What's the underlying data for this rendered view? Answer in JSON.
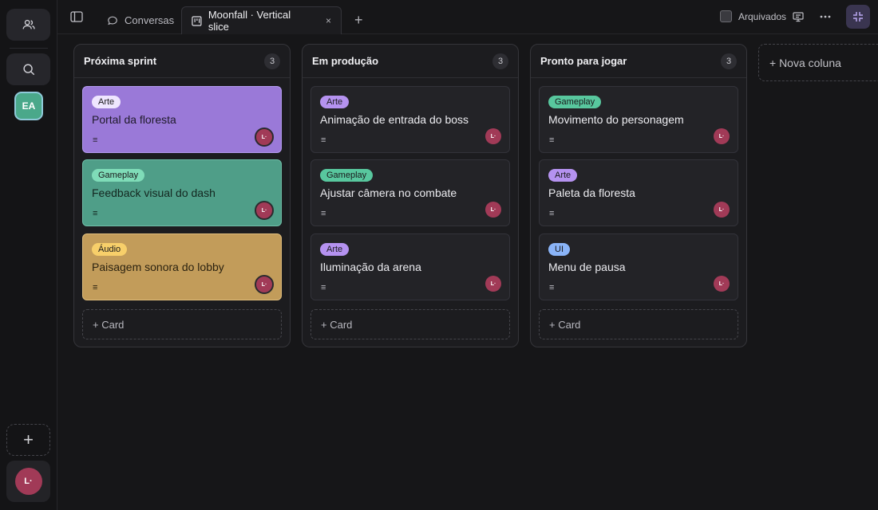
{
  "rail": {
    "workspace_initials": "EA",
    "user_initials": "L·",
    "add_label": "+"
  },
  "topbar": {
    "tabs": [
      {
        "label": "Conversas",
        "icon": "chat-bubble-icon"
      },
      {
        "label": "Moonfall · Vertical slice",
        "icon": "board-icon",
        "close": "×"
      }
    ],
    "new_tab": "+",
    "archived_label": "Arquivados",
    "archived_checked": false
  },
  "colors": {
    "Arte": "#b592f0",
    "Gameplay": "#58c79e",
    "Áudio": "#f2c25c",
    "UI": "#8ab4f8",
    "card_purple": "#9a79d8",
    "card_teal": "#4f9e88",
    "card_gold": "#c29c5a"
  },
  "board": {
    "columns": [
      {
        "title": "Próxima sprint",
        "count": "3",
        "add_card": "+ Card",
        "cards": [
          {
            "tag": "Arte",
            "title": "Portal da floresta",
            "desc": "≡",
            "avatar": "L·",
            "bg": "#9a79d8"
          },
          {
            "tag": "Gameplay",
            "title": "Feedback visual do dash",
            "desc": "≡",
            "avatar": "L·",
            "bg": "#4f9e88"
          },
          {
            "tag": "Áudio",
            "title": "Paisagem sonora do lobby",
            "desc": "≡",
            "avatar": "L·",
            "bg": "#c29c5a"
          }
        ]
      },
      {
        "title": "Em produção",
        "count": "3",
        "add_card": "+ Card",
        "cards": [
          {
            "tag": "Arte",
            "title": "Animação de entrada do boss",
            "desc": "≡",
            "avatar": "L·"
          },
          {
            "tag": "Gameplay",
            "title": "Ajustar câmera no combate",
            "desc": "≡",
            "avatar": "L·"
          },
          {
            "tag": "Arte",
            "title": "Iluminação da arena",
            "desc": "≡",
            "avatar": "L·"
          }
        ]
      },
      {
        "title": "Pronto para jogar",
        "count": "3",
        "add_card": "+ Card",
        "cards": [
          {
            "tag": "Gameplay",
            "title": "Movimento do personagem",
            "desc": "≡",
            "avatar": "L·"
          },
          {
            "tag": "Arte",
            "title": "Paleta da floresta",
            "desc": "≡",
            "avatar": "L·"
          },
          {
            "tag": "UI",
            "title": "Menu de pausa",
            "desc": "≡",
            "avatar": "L·"
          }
        ]
      }
    ],
    "new_column": "+ Nova coluna"
  }
}
